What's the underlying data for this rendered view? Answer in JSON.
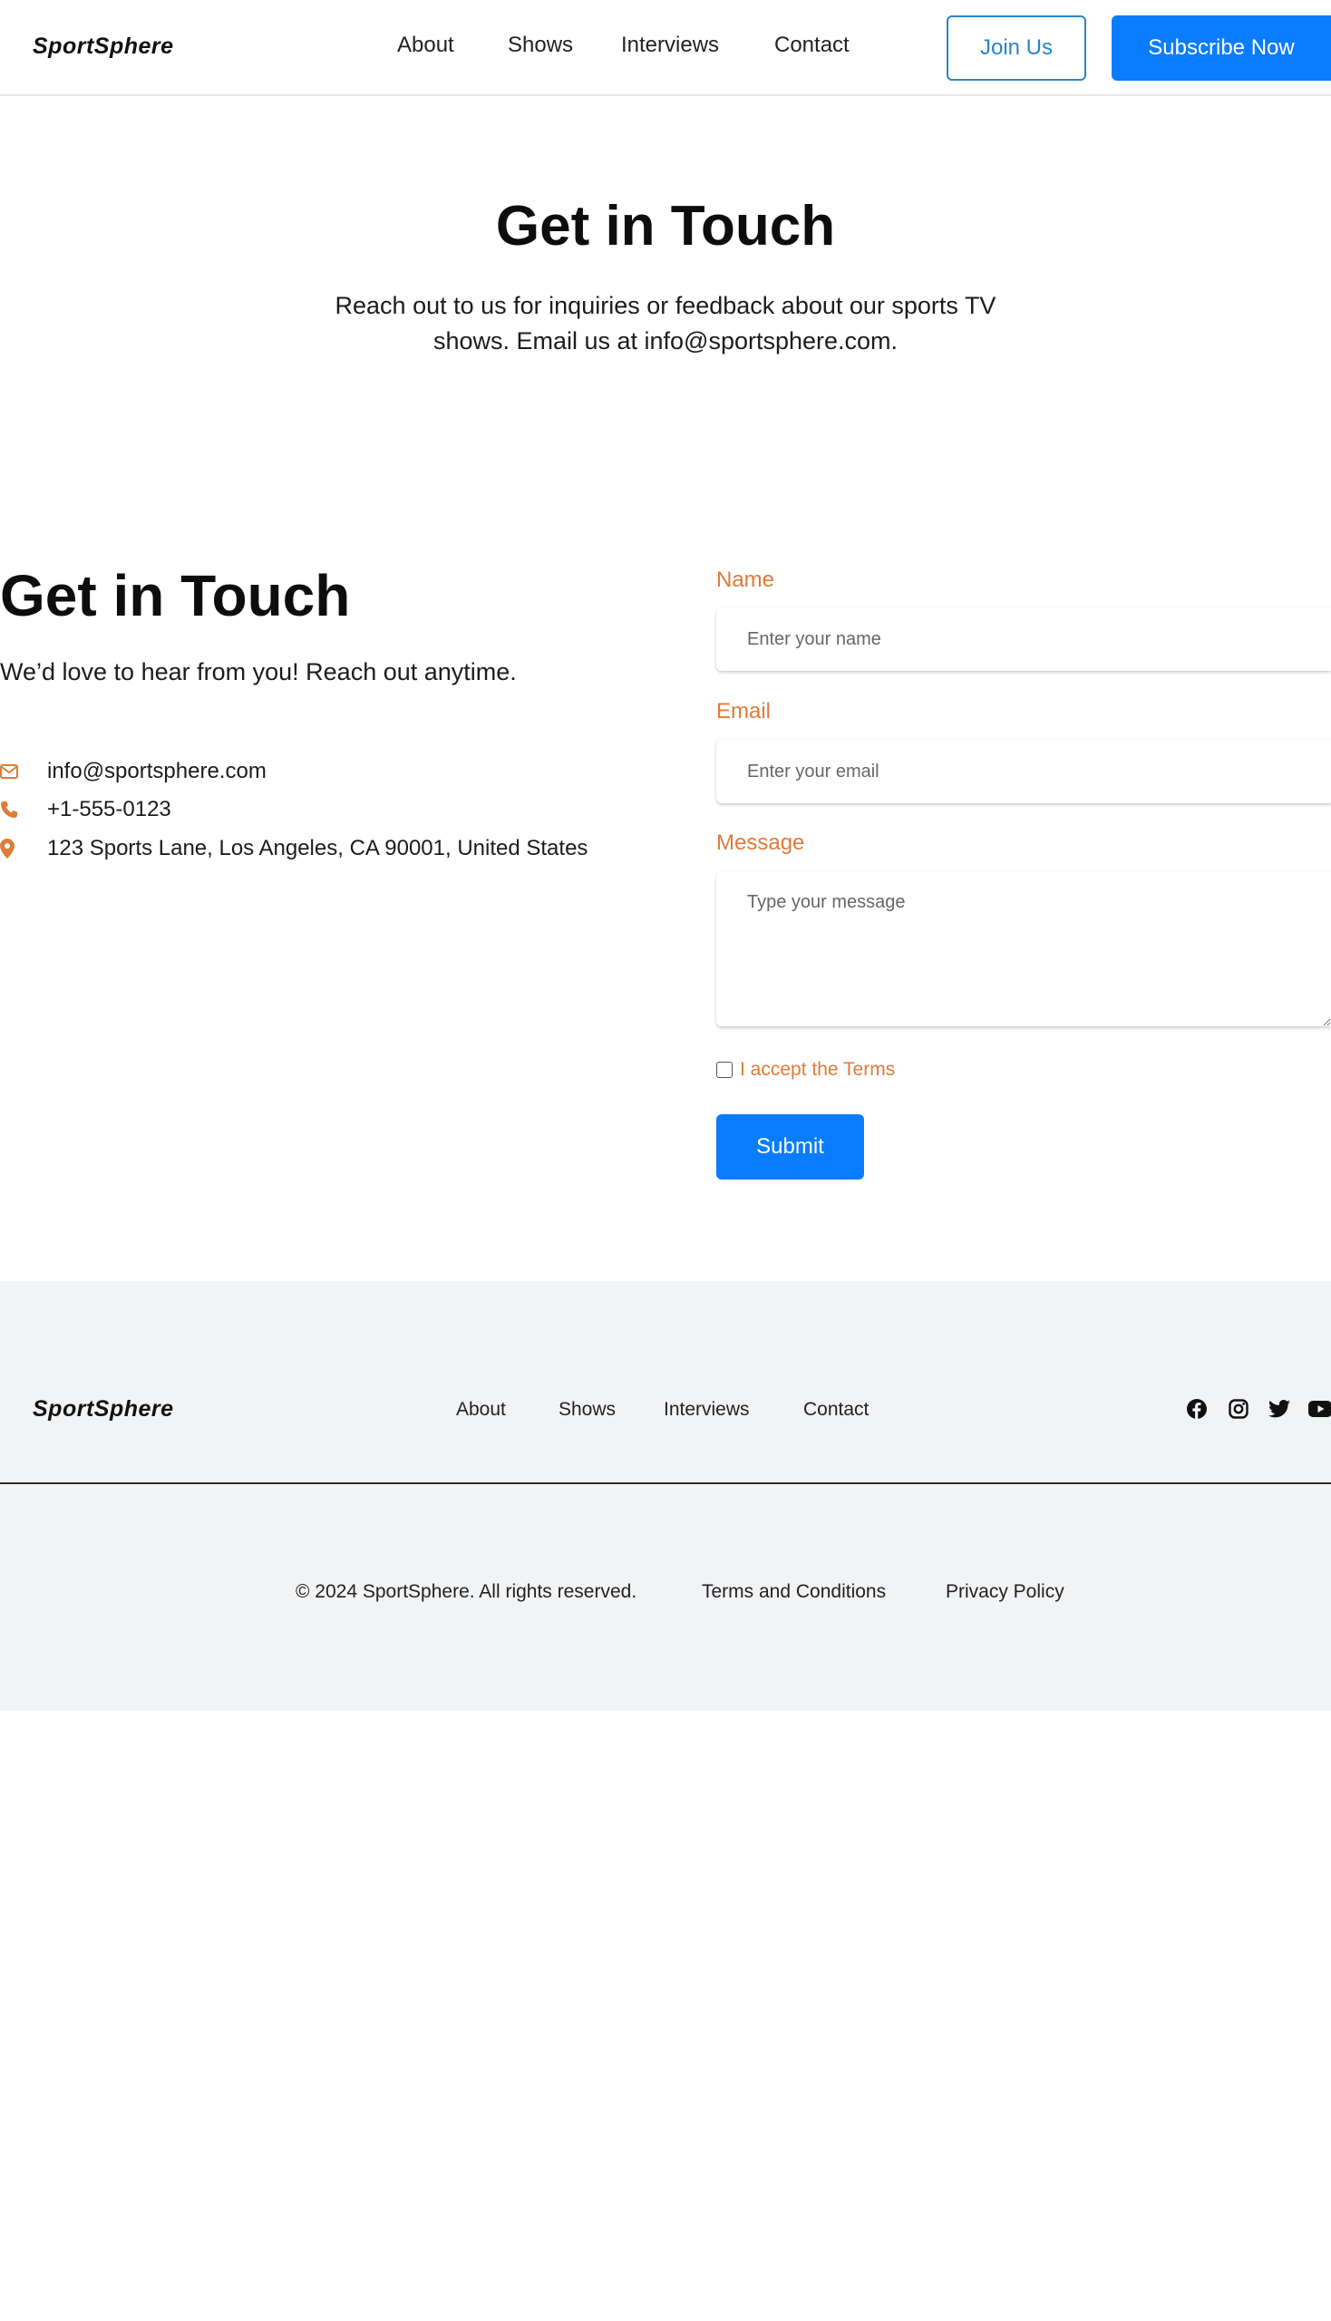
{
  "header": {
    "logo": "SportSphere",
    "nav": [
      {
        "label": "About"
      },
      {
        "label": "Shows"
      },
      {
        "label": "Interviews"
      },
      {
        "label": "Contact"
      }
    ],
    "join_label": "Join Us",
    "subscribe_label": "Subscribe Now"
  },
  "hero": {
    "title": "Get in Touch",
    "subtitle": "Reach out to us for inquiries or feedback about our sports TV shows. Email us at info@sportsphere.com."
  },
  "contact": {
    "title": "Get in Touch",
    "subtitle": "We’d love to hear from you! Reach out anytime.",
    "email": "info@sportsphere.com",
    "phone": "+1-555-0123",
    "address": "123 Sports Lane, Los Angeles, CA 90001, United States",
    "icons": [
      "envelope-icon",
      "phone-icon",
      "map-pin-icon"
    ]
  },
  "form": {
    "name_label": "Name",
    "name_placeholder": "Enter your name",
    "name_value": "",
    "email_label": "Email",
    "email_placeholder": "Enter your email",
    "email_value": "",
    "message_label": "Message",
    "message_placeholder": "Type your message",
    "message_value": "",
    "terms_label": "I accept the Terms",
    "terms_checked": false,
    "submit_label": "Submit"
  },
  "footer": {
    "logo": "SportSphere",
    "nav": [
      {
        "label": "About"
      },
      {
        "label": "Shows"
      },
      {
        "label": "Interviews"
      },
      {
        "label": "Contact"
      }
    ],
    "social": [
      "facebook-icon",
      "instagram-icon",
      "twitter-icon",
      "youtube-icon"
    ],
    "copyright": "© 2024 SportSphere. All rights reserved.",
    "terms": "Terms and Conditions",
    "privacy": "Privacy Policy"
  },
  "colors": {
    "accent_orange": "#e07b39",
    "primary_blue": "#0a7cff",
    "outline_blue": "#2a86c9",
    "footer_bg": "#f2f3f5"
  }
}
